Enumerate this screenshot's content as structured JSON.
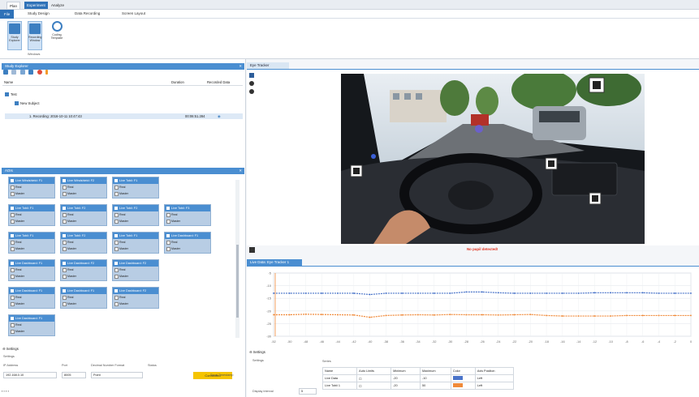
{
  "titlebar": {
    "tabs": [
      "Plan",
      "Experiment",
      "Analyze"
    ],
    "active_index": 0
  },
  "menu": {
    "file": "File",
    "tabs": [
      "Study Design",
      "Data Recording",
      "Screen Layout"
    ]
  },
  "ribbon": {
    "buttons": [
      {
        "label": "Study Explorer",
        "icon": "folder-icon"
      },
      {
        "label": "Recording Window",
        "icon": "window-icon"
      },
      {
        "label": "Coding Template",
        "icon": "template-icon"
      }
    ],
    "group_label": "Windows"
  },
  "study_explorer": {
    "title": "Study Explorer",
    "columns": [
      "Name",
      "Duration",
      "Recorded Data"
    ],
    "tree": {
      "root": "Test",
      "subject": "New Subject",
      "recording": "1. Recording: 2016-10-11 10:47:43",
      "duration": "00:06:51.284"
    }
  },
  "aoi_panel": {
    "title": "AOIs",
    "cards": [
      {
        "name": "Live Windshield: F1",
        "opt1": "Real",
        "opt2": "Master"
      },
      {
        "name": "Live Windshield: F2",
        "opt1": "Real",
        "opt2": "Master"
      },
      {
        "name": "Live Tobii: F1",
        "opt1": "Real",
        "opt2": "Master"
      },
      {
        "name": "Live Tobii: F1",
        "opt1": "Real",
        "opt2": "Master"
      },
      {
        "name": "Live Tobii: F2",
        "opt1": "Real",
        "opt2": "Master"
      },
      {
        "name": "Live Tobii: F2",
        "opt1": "Real",
        "opt2": "Master"
      },
      {
        "name": "Live Tobii: F3",
        "opt1": "Real",
        "opt2": "Master"
      },
      {
        "name": "Live Tobii: F1",
        "opt1": "Real",
        "opt2": "Master"
      },
      {
        "name": "Live Tobii: F2",
        "opt1": "Real",
        "opt2": "Master"
      },
      {
        "name": "Live Tobii: F1",
        "opt1": "Real",
        "opt2": "Master"
      },
      {
        "name": "Live Dashboard: F1",
        "opt1": "Real",
        "opt2": "Master"
      },
      {
        "name": "Live Dashboard: F1",
        "opt1": "Real",
        "opt2": "Master"
      },
      {
        "name": "Live Dashboard: F2",
        "opt1": "Real",
        "opt2": "Master"
      },
      {
        "name": "Live Dashboard: F2",
        "opt1": "Real",
        "opt2": "Master"
      },
      {
        "name": "Live Dashboard: F1",
        "opt1": "Real",
        "opt2": "Master"
      },
      {
        "name": "Live Dashboard: F1",
        "opt1": "Real",
        "opt2": "Master"
      },
      {
        "name": "Live Dashboard: F2",
        "opt1": "Real",
        "opt2": "Master"
      },
      {
        "name": "Live Dashboard: F1",
        "opt1": "Real",
        "opt2": "Master"
      }
    ]
  },
  "settings_left": {
    "title": "Settings",
    "group": "Settings",
    "ip_label": "IP Address",
    "ip_value": "192.168.0.10",
    "port_label": "Port",
    "port_value": "8005",
    "decimal_label": "Decimal Number Format",
    "decimal_value": "Point",
    "status_label": "Status",
    "status_value": "Connected",
    "send_time": "Send Timestamp"
  },
  "eye_tracker": {
    "title": "Eye Tracker",
    "no_pupil": "No pupil detected!"
  },
  "chart_panel": {
    "title": "Live Data: Eye Tracker 1",
    "settings_title": "Settings",
    "settings_group": "Settings",
    "series_group": "Series",
    "display_interval_label": "Display interval",
    "display_interval_value": "5",
    "table_headers": [
      "Name",
      "Auto Limits",
      "Minimum",
      "Maximum",
      "Color",
      "Axis Position"
    ],
    "table_rows": [
      {
        "name": "Live Data",
        "min": "-20",
        "max": "-10",
        "axis": "Left",
        "color": "#4a74c9"
      },
      {
        "name": "Live Tobii 1",
        "min": "-20",
        "max": "50",
        "axis": "Left",
        "color": "#f08a3a"
      }
    ]
  },
  "chart_data": {
    "type": "line",
    "x": [
      -52,
      -50,
      -48,
      -46,
      -44,
      -42,
      -40,
      -38,
      -36,
      -34,
      -32,
      -30,
      -28,
      -26,
      -24,
      -22,
      -20,
      -18,
      -16,
      -14,
      -12,
      -10,
      -8,
      -6,
      -4,
      -2,
      0
    ],
    "xlim": [
      -52,
      0
    ],
    "series": [
      {
        "name": "Live Data",
        "color": "#4a74c9",
        "values": [
          -13,
          -13,
          -13,
          -13,
          -13,
          -13,
          -13.5,
          -13,
          -13,
          -13,
          -13,
          -13,
          -12.5,
          -12.5,
          -12.8,
          -13,
          -13,
          -13,
          -13,
          -13,
          -12.8,
          -12.8,
          -12.8,
          -12.8,
          -13,
          -13,
          -13
        ]
      },
      {
        "name": "Live Tobii 1",
        "color": "#f08a3a",
        "values": [
          -21.5,
          -21.5,
          -21.3,
          -21.4,
          -21.5,
          -21.6,
          -22.5,
          -21.8,
          -21.6,
          -21.5,
          -21.6,
          -21.4,
          -21.5,
          -21.5,
          -21.6,
          -21.5,
          -21.4,
          -21.8,
          -22.0,
          -22.0,
          -22.0,
          -22.0,
          -21.8,
          -21.8,
          -21.8,
          -21.8,
          -21.8
        ]
      }
    ],
    "ylim": [
      -30,
      -5
    ],
    "grid": true
  }
}
